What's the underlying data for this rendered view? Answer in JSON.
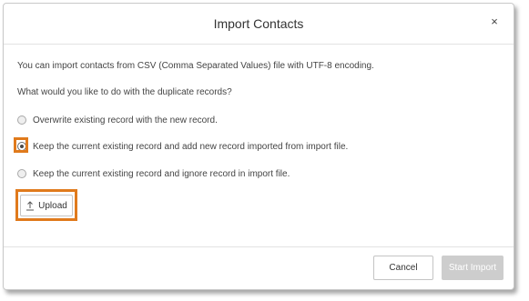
{
  "dialog": {
    "title": "Import Contacts",
    "close_label": "×",
    "intro": "You can import contacts from CSV (Comma Separated Values) file with UTF-8 encoding.",
    "question": "What would you like to do with the duplicate records?"
  },
  "options": [
    {
      "label": "Overwrite existing record with the new record.",
      "checked": false
    },
    {
      "label": "Keep the current existing record and add new record imported from import file.",
      "checked": true
    },
    {
      "label": "Keep the current existing record and ignore record in import file.",
      "checked": false
    }
  ],
  "upload": {
    "label": "Upload",
    "icon": "upload-icon"
  },
  "footer": {
    "cancel_label": "Cancel",
    "start_label": "Start Import",
    "start_disabled": true
  },
  "colors": {
    "highlight": "#e07a1c",
    "disabled_button": "#cdcdcd"
  }
}
